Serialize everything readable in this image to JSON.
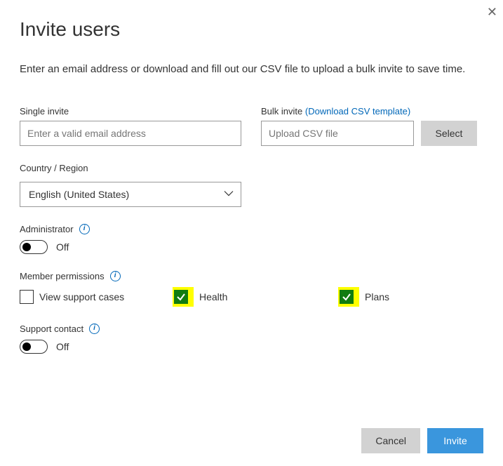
{
  "dialog": {
    "title": "Invite users",
    "description": "Enter an email address or download and fill out our CSV file to upload a bulk invite to save time."
  },
  "single_invite": {
    "label": "Single invite",
    "placeholder": "Enter a valid email address",
    "value": ""
  },
  "bulk_invite": {
    "label": "Bulk invite",
    "link_text": "(Download CSV template)",
    "placeholder": "Upload CSV file",
    "value": "",
    "select_button": "Select"
  },
  "country": {
    "label": "Country / Region",
    "selected": "English (United States)"
  },
  "administrator": {
    "label": "Administrator",
    "state": "Off"
  },
  "permissions": {
    "label": "Member permissions",
    "items": {
      "view_support_cases": {
        "label": "View support cases",
        "checked": false
      },
      "health": {
        "label": "Health",
        "checked": true,
        "highlighted": true
      },
      "plans": {
        "label": "Plans",
        "checked": true,
        "highlighted": true
      }
    }
  },
  "support_contact": {
    "label": "Support contact",
    "state": "Off"
  },
  "footer": {
    "cancel": "Cancel",
    "invite": "Invite"
  }
}
